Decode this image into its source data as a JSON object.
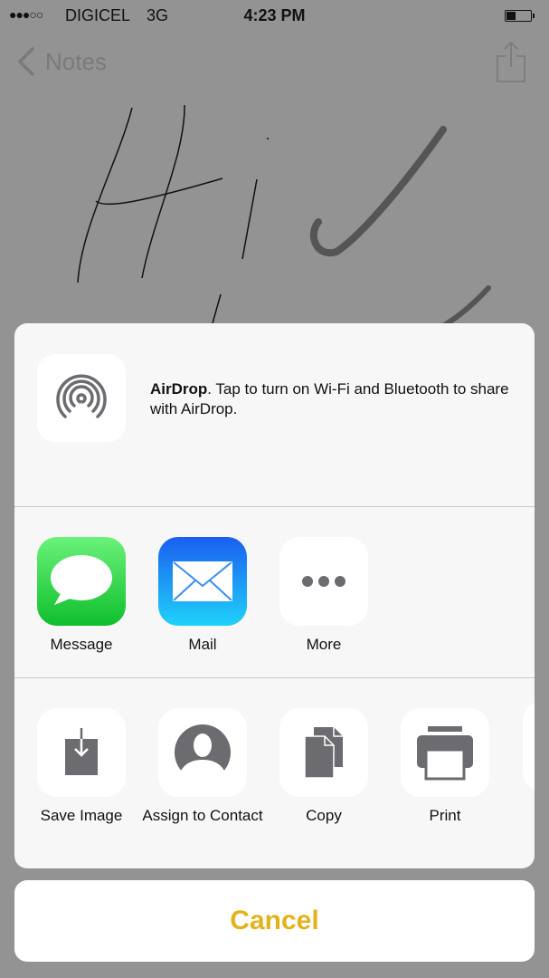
{
  "status_bar": {
    "signal": "●●●○○",
    "carrier": "DIGICEL",
    "network": "3G",
    "time": "4:23 PM",
    "battery_level": 0.4
  },
  "nav": {
    "back_label": "Notes",
    "back_icon": "chevron-left-icon",
    "share_icon": "share-icon"
  },
  "note": {
    "content": "handwritten sketch: \"Hi\" and checkmarks"
  },
  "share_sheet": {
    "airdrop": {
      "icon": "airdrop-icon",
      "title": "AirDrop",
      "message": ". Tap to turn on Wi-Fi and Bluetooth to share with AirDrop."
    },
    "share_apps": [
      {
        "label": "Message",
        "icon": "messages-icon"
      },
      {
        "label": "Mail",
        "icon": "mail-icon"
      },
      {
        "label": "More",
        "icon": "more-icon"
      }
    ],
    "actions": [
      {
        "label": "Save Image",
        "icon": "save-image-icon"
      },
      {
        "label": "Assign to Contact",
        "icon": "contact-icon"
      },
      {
        "label": "Copy",
        "icon": "copy-icon"
      },
      {
        "label": "Print",
        "icon": "print-icon"
      }
    ]
  },
  "cancel": {
    "label": "Cancel",
    "color": "#e3b21d"
  }
}
